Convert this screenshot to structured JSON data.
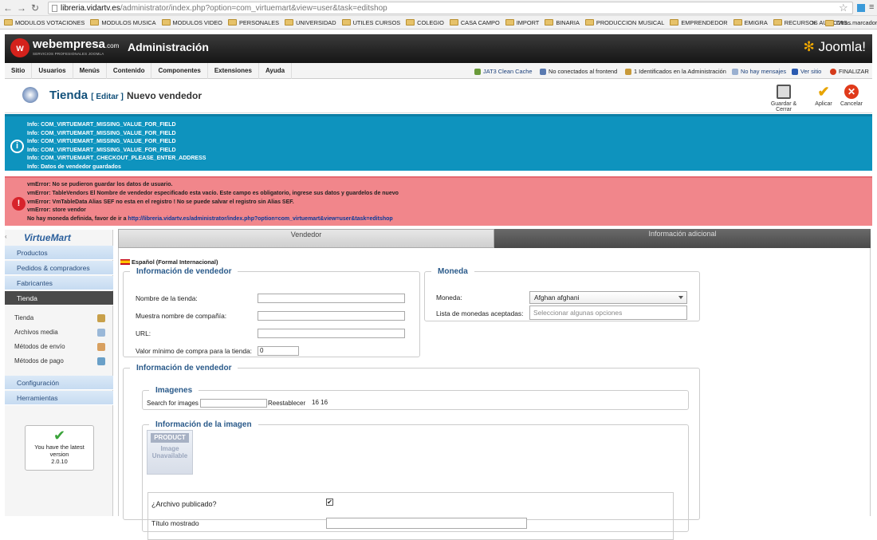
{
  "browser": {
    "url_host": "libreria.vidartv.es",
    "url_path": "/administrator/index.php?option=com_virtuemart&view=user&task=editshop",
    "bookmarks": [
      "MODULOS VOTACIONES",
      "MODULOS MUSICA",
      "MODULOS VIDEO",
      "PERSONALES",
      "UNIVERSIDAD",
      "UTILES CURSOS",
      "COLEGIO",
      "CASA CAMPO",
      "IMPORT",
      "BINARIA",
      "PRODUCCION MUSICAL",
      "EMPRENDEDOR",
      "EMIGRA",
      "RECURSOS AUDIOVIS..."
    ],
    "bookmarks_more": "»",
    "other_bookmarks": "Otros marcador"
  },
  "header": {
    "logo_mark": "w",
    "logo_text": "webempresa",
    "logo_suffix": ".com",
    "logo_sub": "SERVICIOS PROFESIONALES JOOMLA",
    "admin_title": "Administración",
    "brand": "Joomla!"
  },
  "menu": [
    "Sitio",
    "Usuarios",
    "Menús",
    "Contenido",
    "Componentes",
    "Extensiones",
    "Ayuda"
  ],
  "status": {
    "cache": "JAT3 Clean Cache",
    "frontend": "No conectados al frontend",
    "admin": "1 Identificados en la Administración",
    "messages": "No hay mensajes",
    "view_site": "Ver sitio",
    "logout": "FINALIZAR"
  },
  "toolbar": {
    "title": "Tienda",
    "edit": "[ Editar ]",
    "subtitle": "Nuevo vendedor",
    "save_close": "Guardar & Cerrar",
    "apply": "Aplicar",
    "cancel": "Cancelar"
  },
  "info_messages": [
    "Info: COM_VIRTUEMART_MISSING_VALUE_FOR_FIELD",
    "Info: COM_VIRTUEMART_MISSING_VALUE_FOR_FIELD",
    "Info: COM_VIRTUEMART_MISSING_VALUE_FOR_FIELD",
    "Info: COM_VIRTUEMART_MISSING_VALUE_FOR_FIELD",
    "Info: COM_VIRTUEMART_CHECKOUT_PLEASE_ENTER_ADDRESS",
    "Info: Datos de vendedor guardados"
  ],
  "error_messages": [
    "vmError: No se pudieron guardar los datos de usuario.",
    "vmError: TableVendors El Nombre de vendedor especificado esta vacío. Este campo es obligatorio, ingrese sus datos y guardelos de nuevo",
    "vmError: VmTableData Alias SEF no esta en el registro ! No se puede salvar el registro sin Alias SEF.",
    "vmError: store vendor"
  ],
  "error_last_prefix": "No hay moneda definida, favor de ir a ",
  "error_last_link": "http://libreria.vidartv.es/administrator/index.php?option=com_virtuemart&view=user&task=editshop",
  "sidebar": {
    "logo": "VirtueMart",
    "sections": [
      "Productos",
      "Pedidos & compradores",
      "Fabricantes",
      "Tienda"
    ],
    "items": [
      "Tienda",
      "Archivos media",
      "Métodos de envío",
      "Métodos de pago"
    ],
    "bottom_sections": [
      "Configuración",
      "Herramientas"
    ],
    "version_lines": [
      "You have the latest",
      "version",
      "2.0.10"
    ]
  },
  "tabs": [
    "Vendedor",
    "Información adicional"
  ],
  "language": "Español (Formal Internacional)",
  "vendor_info": {
    "legend": "Información de vendedor",
    "store_name_label": "Nombre de la tienda:",
    "company_label": "Muestra nombre de compañía:",
    "url_label": "URL:",
    "min_purchase_label": "Valor mínimo de compra para la tienda:",
    "min_purchase_value": "0"
  },
  "currency": {
    "legend": "Moneda",
    "currency_label": "Moneda:",
    "currency_value": "Afghan afghani",
    "accepted_label": "Lista de monedas aceptadas:",
    "accepted_placeholder": "Seleccionar algunas opciones"
  },
  "vendor_info2": {
    "legend": "Información de vendedor",
    "images_legend": "Imagenes",
    "search_label": "Search for images",
    "reset_button": "Reestablecer",
    "counts": "16 16",
    "image_info_legend": "Información de la imagen",
    "img_placeholder_top": "PRODUCT",
    "img_placeholder_line1": "Image",
    "img_placeholder_line2": "Unavailable",
    "published_label": "¿Archivo publicado?",
    "published_mark": "✔",
    "shown_title_label": "Título mostrado"
  },
  "colors": {
    "info_bg": "#0e93be",
    "error_bg": "#f1868b",
    "sidebar_active": "#4a4a4a",
    "title_blue": "#11507a"
  }
}
